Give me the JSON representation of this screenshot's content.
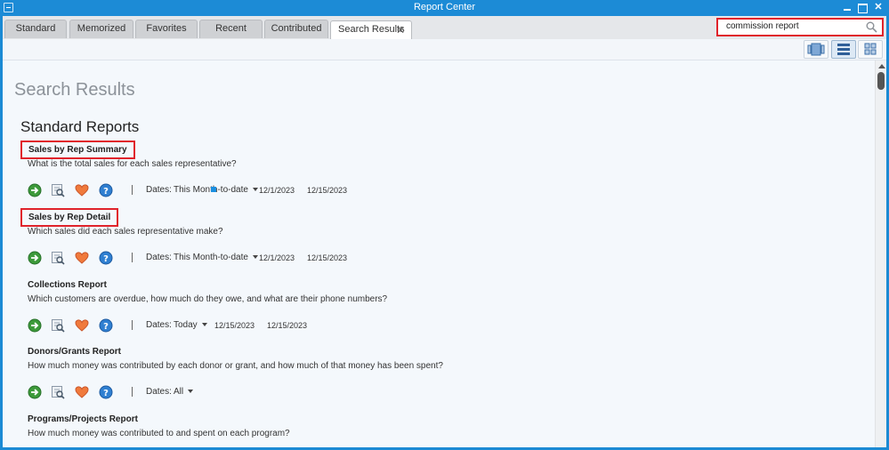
{
  "window": {
    "title": "Report Center"
  },
  "tabs": [
    {
      "label": "Standard"
    },
    {
      "label": "Memorized"
    },
    {
      "label": "Favorites"
    },
    {
      "label": "Recent"
    },
    {
      "label": "Contributed"
    },
    {
      "label": "Search Results",
      "active": true,
      "close_glyph": "✕"
    }
  ],
  "search": {
    "value": "commission report",
    "icon": "search-icon"
  },
  "toolbar": {
    "views": [
      "carousel-view-icon",
      "list-view-icon",
      "grid-view-icon"
    ],
    "active_view": "list-view-icon"
  },
  "page": {
    "title": "Search Results",
    "section_title": "Standard Reports"
  },
  "reports": [
    {
      "name": "Sales by Rep Summary",
      "description": "What is the total sales for each sales representative?",
      "dates_label": "Dates:",
      "dates_value": "This Month-to-date",
      "from": "12/1/2023",
      "to": "12/15/2023",
      "highlighted": true
    },
    {
      "name": "Sales by Rep Detail",
      "description": "Which sales did each sales representative make?",
      "dates_label": "Dates:",
      "dates_value": "This Month-to-date",
      "from": "12/1/2023",
      "to": "12/15/2023",
      "highlighted": true
    },
    {
      "name": "Collections Report",
      "description": "Which customers are overdue, how much do they owe, and what are their phone numbers?",
      "dates_label": "Dates:",
      "dates_value": "Today",
      "from": "12/15/2023",
      "to": "12/15/2023",
      "highlighted": false
    },
    {
      "name": "Donors/Grants Report",
      "description": "How much money was contributed by each donor or grant, and how much of that money has been spent?",
      "dates_label": "Dates:",
      "dates_value": "All",
      "from": "",
      "to": "",
      "highlighted": false
    },
    {
      "name": "Programs/Projects Report",
      "description": "How much money was contributed to and spent on each program?",
      "highlighted": false
    }
  ],
  "colors": {
    "highlight": "#e0232b",
    "accent": "#1c8bd6"
  }
}
